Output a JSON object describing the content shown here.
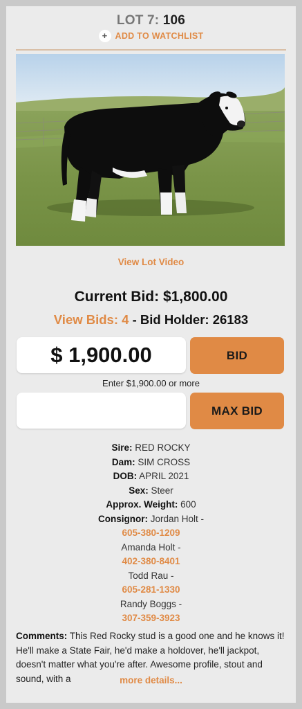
{
  "lot": {
    "prefix": "LOT 7:",
    "number": "106"
  },
  "watchlist": {
    "plus": "+",
    "label": "ADD TO WATCHLIST"
  },
  "photo": {
    "subject": "black and white steer standing in pasture"
  },
  "video_link": "View Lot Video",
  "bidding": {
    "current_bid_label": "Current Bid:",
    "current_bid": "$1,800.00",
    "view_bids": "View Bids: 4",
    "holder_label": "- Bid Holder:",
    "holder": "26183",
    "bid_amount": "$ 1,900.00",
    "bid_button": "BID",
    "hint": "Enter $1,900.00 or more",
    "max_bid_button": "MAX BID",
    "max_bid_value": ""
  },
  "details": {
    "sire_label": "Sire:",
    "sire": "RED ROCKY",
    "dam_label": "Dam:",
    "dam": "SIM CROSS",
    "dob_label": "DOB:",
    "dob": "APRIL 2021",
    "sex_label": "Sex:",
    "sex": "Steer",
    "weight_label": "Approx. Weight:",
    "weight": "600",
    "consignor_label": "Consignor:",
    "consignors": [
      {
        "name": "Jordan Holt -",
        "phone": "605-380-1209"
      },
      {
        "name": "Amanda Holt -",
        "phone": "402-380-8401"
      },
      {
        "name": "Todd Rau -",
        "phone": "605-281-1330"
      },
      {
        "name": "Randy Boggs -",
        "phone": "307-359-3923"
      }
    ]
  },
  "comments": {
    "label": "Comments:",
    "text": "This Red Rocky stud is a good one and he knows it! He'll make a State Fair, he'd make a holdover, he'll jackpot, doesn't matter what you're after. Awesome profile, stout and sound, with a",
    "more": "more details..."
  },
  "colors": {
    "accent": "#e08a45",
    "card": "#ebebeb",
    "frame": "#c9c9c9"
  }
}
